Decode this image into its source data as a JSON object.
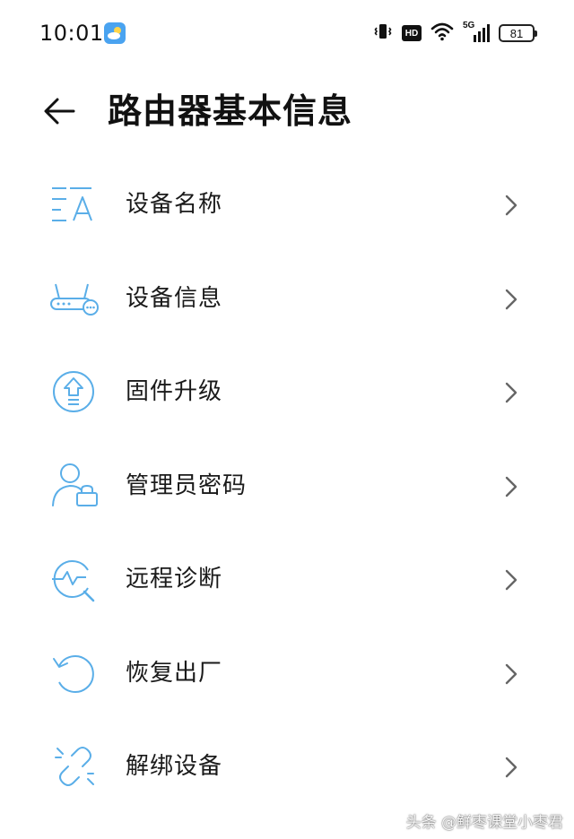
{
  "status_bar": {
    "time": "10:01",
    "hd_label": "HD",
    "network_label": "5G",
    "battery": "81"
  },
  "header": {
    "title": "路由器基本信息"
  },
  "menu": {
    "items": [
      {
        "label": "设备名称",
        "icon": "rename-icon"
      },
      {
        "label": "设备信息",
        "icon": "router-icon"
      },
      {
        "label": "固件升级",
        "icon": "firmware-upgrade-icon"
      },
      {
        "label": "管理员密码",
        "icon": "admin-lock-icon"
      },
      {
        "label": "远程诊断",
        "icon": "remote-diagnosis-icon"
      },
      {
        "label": "恢复出厂",
        "icon": "factory-reset-icon"
      },
      {
        "label": "解绑设备",
        "icon": "unbind-icon"
      }
    ]
  },
  "watermark": "头条 @鲜枣课堂小枣君",
  "colors": {
    "icon_accent": "#5aaee8",
    "text": "#1a1a1a",
    "chevron": "#666666",
    "background": "#ffffff"
  }
}
